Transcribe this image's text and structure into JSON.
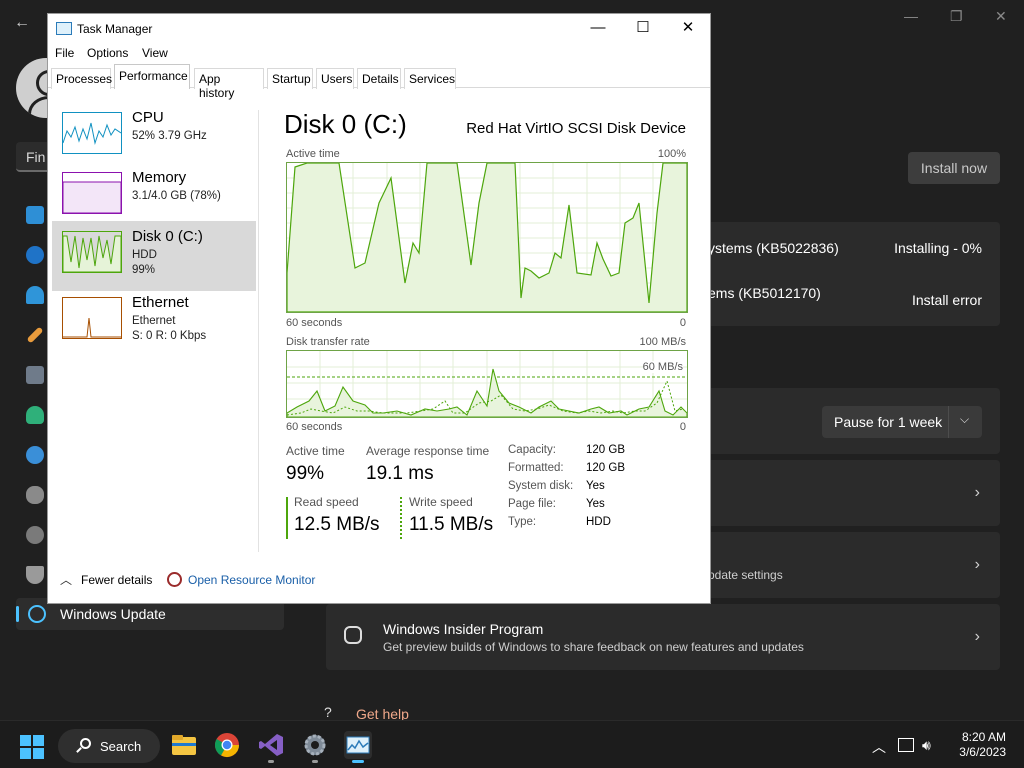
{
  "settings": {
    "find_placeholder": "Fin",
    "nav_active_label": "Windows Update",
    "install_now": "Install now",
    "updates": [
      {
        "title_partial": "ystems (KB5022836)",
        "status": "Installing - 0%"
      },
      {
        "title_partial": "ems (KB5012170)",
        "status": "Install error"
      }
    ],
    "pause": {
      "label": "Pause for 1 week",
      "chevron": "chevron-down-icon"
    },
    "advanced_partial": "pdate settings",
    "insider": {
      "title": "Windows Insider Program",
      "subtitle": "Get preview builds of Windows to share feedback on new features and updates"
    },
    "get_help": "Get help"
  },
  "task_manager": {
    "title": "Task Manager",
    "menu": [
      "File",
      "Options",
      "View"
    ],
    "tabs": [
      "Processes",
      "Performance",
      "App history",
      "Startup",
      "Users",
      "Details",
      "Services"
    ],
    "active_tab": "Performance",
    "resources": [
      {
        "name": "CPU",
        "line2": "52%  3.79 GHz",
        "line3": "",
        "color": "#1191c1"
      },
      {
        "name": "Memory",
        "line2": "3.1/4.0 GB (78%)",
        "line3": "",
        "color": "#8b12ae"
      },
      {
        "name": "Disk 0 (C:)",
        "line2": "HDD",
        "line3": "99%",
        "color": "#4da60c"
      },
      {
        "name": "Ethernet",
        "line2": "Ethernet",
        "line3": "S: 0  R: 0 Kbps",
        "color": "#a74f01"
      }
    ],
    "detail": {
      "title": "Disk 0 (C:)",
      "device": "Red Hat VirtIO SCSI Disk Device",
      "active_time_label": "Active time",
      "active_time_max": "100%",
      "time_span_label": "60 seconds",
      "zero": "0",
      "transfer_label": "Disk transfer rate",
      "transfer_max": "100 MB/s",
      "transfer_ref": "60 MB/s",
      "stats": {
        "active_time_label": "Active time",
        "active_time_value": "99%",
        "avg_response_label": "Average response time",
        "avg_response_value": "19.1 ms",
        "read_label": "Read speed",
        "read_value": "12.5 MB/s",
        "write_label": "Write speed",
        "write_value": "11.5 MB/s"
      },
      "properties": [
        {
          "key": "Capacity:",
          "value": "120 GB"
        },
        {
          "key": "Formatted:",
          "value": "120 GB"
        },
        {
          "key": "System disk:",
          "value": "Yes"
        },
        {
          "key": "Page file:",
          "value": "Yes"
        },
        {
          "key": "Type:",
          "value": "HDD"
        }
      ]
    },
    "footer": {
      "fewer_details": "Fewer details",
      "open_resource_monitor": "Open Resource Monitor"
    }
  },
  "taskbar": {
    "search_label": "Search",
    "time": "8:20 AM",
    "date": "3/6/2023",
    "apps": [
      "file-explorer-icon",
      "chrome-icon",
      "visual-studio-icon",
      "settings-icon",
      "task-manager-icon"
    ]
  },
  "colors": {
    "disk_green": "#4da60c",
    "accent": "#4cc2ff"
  }
}
